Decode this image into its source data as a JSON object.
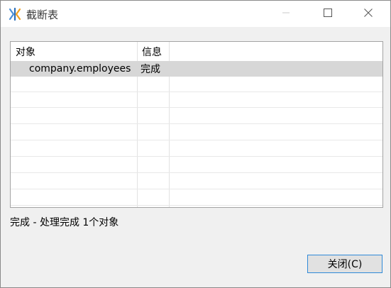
{
  "window": {
    "title": "截断表",
    "icon": "kettle-app-icon"
  },
  "titlebar_buttons": [
    "minimize-icon",
    "maximize-icon",
    "close-icon"
  ],
  "table": {
    "columns": [
      "对象",
      "信息"
    ],
    "rows": [
      {
        "object": "company.employees",
        "info": "完成",
        "selected": true
      }
    ]
  },
  "status": "完成 - 处理完成 1个对象",
  "buttons": {
    "close": "关闭(C)"
  },
  "colors": {
    "accent": "#2f8ad8",
    "selection": "#d7d7d7"
  }
}
